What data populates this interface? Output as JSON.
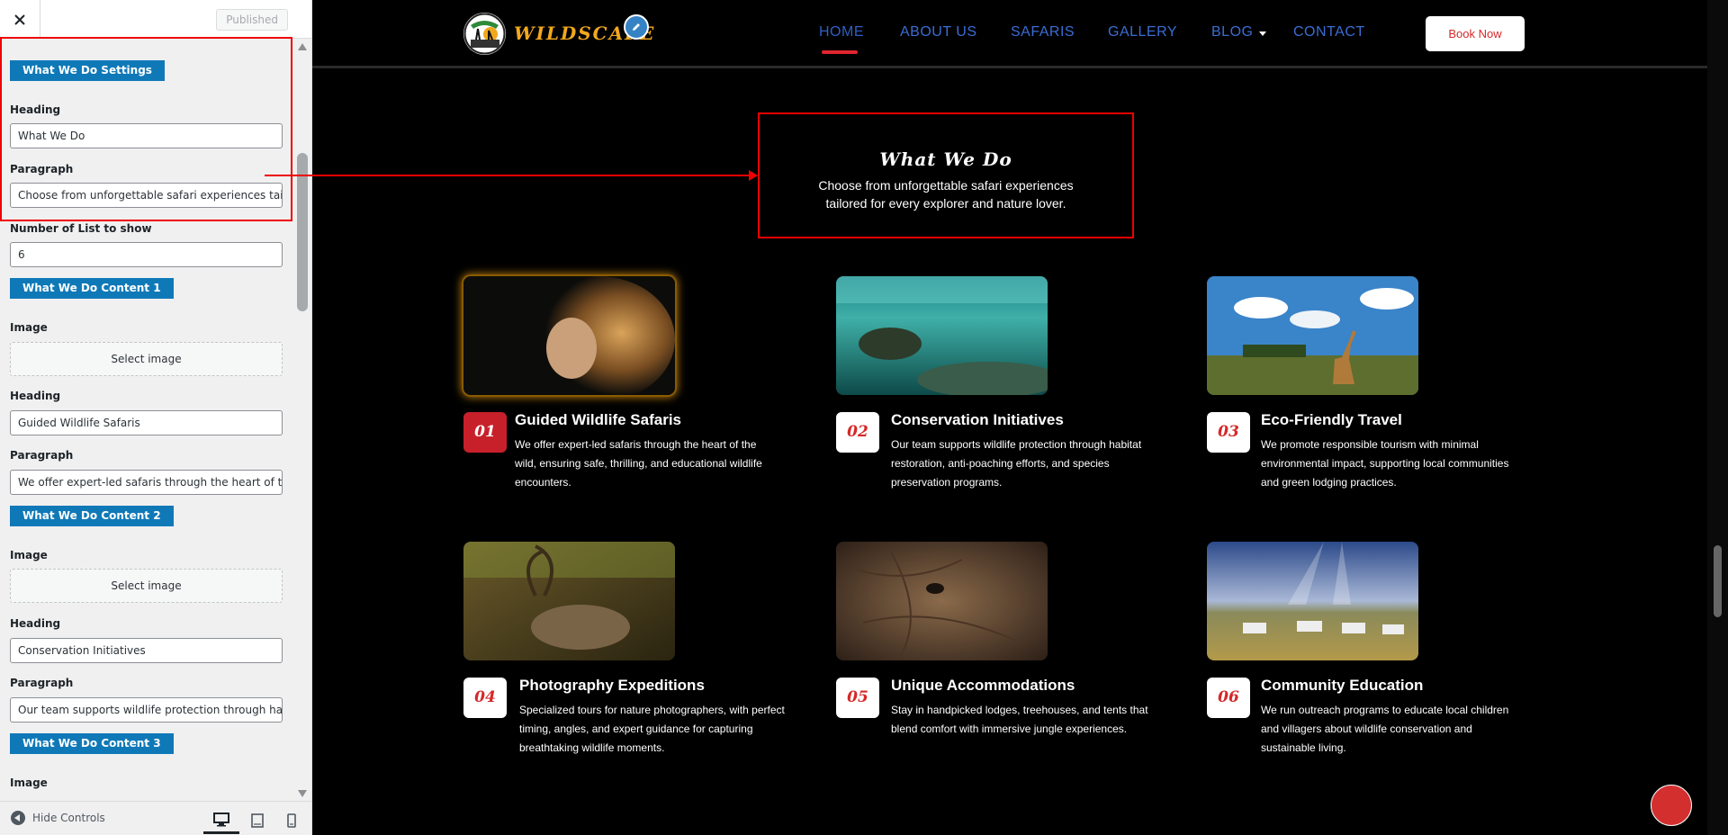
{
  "sidebar": {
    "close_label": "×",
    "published_label": "Published",
    "sections": {
      "settings_title": "What We Do Settings",
      "heading_label": "Heading",
      "heading_value": "What We Do",
      "paragraph_label": "Paragraph",
      "paragraph_value": "Choose from unforgettable safari experiences tailored",
      "number_label": "Number of List to show",
      "number_value": "6",
      "content1_title": "What We Do Content 1",
      "content1_image_label": "Image",
      "content1_select": "Select image",
      "content1_heading_label": "Heading",
      "content1_heading_value": "Guided Wildlife Safaris",
      "content1_paragraph_label": "Paragraph",
      "content1_paragraph_value": "We offer expert-led safaris through the heart of th",
      "content2_title": "What We Do Content 2",
      "content2_image_label": "Image",
      "content2_select": "Select image",
      "content2_heading_label": "Heading",
      "content2_heading_value": "Conservation Initiatives",
      "content2_paragraph_label": "Paragraph",
      "content2_paragraph_value": "Our team supports wildlife protection through ha",
      "content3_title": "What We Do Content 3",
      "content3_image_label": "Image"
    },
    "footer": {
      "hide_controls": "Hide Controls"
    }
  },
  "preview": {
    "logo_text": "WILDSCAPE",
    "nav": [
      "HOME",
      "ABOUT US",
      "SAFARIS",
      "GALLERY",
      "BLOG",
      "CONTACT"
    ],
    "book_now": "Book Now",
    "section_heading": "What We Do",
    "section_paragraph": "Choose from unforgettable safari experiences tailored for every explorer and nature lover.",
    "cards": [
      {
        "num": "01",
        "title": "Guided Wildlife Safaris",
        "text": "We offer expert-led safaris through the heart of the wild, ensuring safe, thrilling, and educational wildlife encounters."
      },
      {
        "num": "02",
        "title": "Conservation Initiatives",
        "text": "Our team supports wildlife protection through habitat restoration, anti-poaching efforts, and species preservation programs."
      },
      {
        "num": "03",
        "title": "Eco-Friendly Travel",
        "text": "We promote responsible tourism with minimal environmental impact, supporting local communities and green lodging practices."
      },
      {
        "num": "04",
        "title": "Photography Expeditions",
        "text": "Specialized tours for nature photographers, with perfect timing, angles, and expert guidance for capturing breathtaking wildlife moments."
      },
      {
        "num": "05",
        "title": "Unique Accommodations",
        "text": "Stay in handpicked lodges, treehouses, and tents that blend comfort with immersive jungle experiences."
      },
      {
        "num": "06",
        "title": "Community Education",
        "text": "We run outreach programs to educate local children and villagers about wildlife conservation and sustainable living."
      }
    ]
  },
  "colors": {
    "accent_blue": "#0f79b8",
    "nav_blue": "#3b6dd3",
    "brand_red": "#d62828",
    "logo_orange": "#f2a81d"
  }
}
